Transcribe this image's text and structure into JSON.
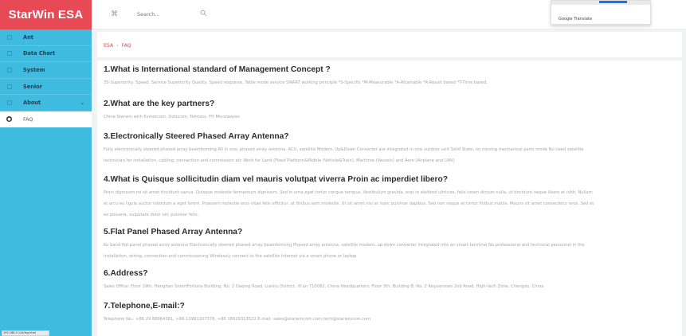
{
  "app": {
    "brand": "StarWin ESA"
  },
  "sidebar": {
    "items": [
      {
        "label": "Ant"
      },
      {
        "label": "Data Chart"
      },
      {
        "label": "System"
      },
      {
        "label": "Senior"
      },
      {
        "label": "About"
      }
    ],
    "subitems": [
      {
        "label": "FAQ"
      }
    ]
  },
  "header": {
    "close_glyph": "⌘",
    "search_placeholder": "Search...",
    "translate_label": "Google Translate"
  },
  "breadcrumb": {
    "root": "ESA",
    "current": "FAQ"
  },
  "status_text": "192.168.0.1/#/faq.html",
  "faq": [
    {
      "q": "1.What is International standard of Management Concept ?",
      "a": [
        "3S-Superiority, Speed, Service Superiority Quality, Speed response, Table mode service SMART working principle *S-Specific *M-Measurable *A-Attainable *R-Result based *T-Time based."
      ]
    },
    {
      "q": "2.What are the key partners?",
      "a": [
        "China Starwin with Evmorcom,  Dotocom,  Telmoss,  FH Microwaves"
      ]
    },
    {
      "q": "3.Electronically Steered Phased Array Antenna?",
      "a": [
        "Fully electronically steered phased array beamforming All in one, phased array antenna, ACU, satellite Modem, Up&Down Converter are integrated in one outdoor unit Solid State, no moving mechanical parts mode No need satellite",
        "technician for installation, cabling, connection and commission etc Work for Land (Fixed Platform&Mobile (Vehicle&Train), Maritime (Vessels) and Aero (Airplane and UAV)"
      ]
    },
    {
      "q": "4.What is Quisque sollicitudin diam vel mauris volutpat viverra Proin ac imperdiet libero?",
      "a": [
        "Proin dignissim mi sit amet tincidunt varius. Quisque molestie fermentum dignissim. Sed in urna eget tortor congue tempus. Vestibulum gravida, erat in eleifend ultricies, felis lorem dictum nulla, ut tincidunt neque libero et nibh. Nullam",
        "et arcu eu ligula auctor interdum a eget lorem. Praesent molestie eros vitae felis efficitur, at finibus sem molestie. Ut sit amet nisi at nunc pulvinar dapibus. Sed non neque et tortor finibus mattis. Mauris sit amet consectetur eros. Sed et",
        "ex posuere, vulputate dolor vel, pulvinar felis."
      ]
    },
    {
      "q": "5.Flat Panel Phased Array Antenna?",
      "a": [
        "Ku band flat panel phased array antenna Electronically steered phased array beamforming Phased array antenna, satellite modem, up-down converter integrated into an smart terminal No professional and technical personnel in the",
        "installation, wiring, connection and commissioning Wirelessly connect to the satellite Internet via a smart phone or laptop"
      ]
    },
    {
      "q": "6.Address?",
      "a": [
        "Sales Office: Floor 19th, Hengtian SmartFortune Building, No. 2 Daqing Road, Lianhu District, Xi'an 710082, China Headquarters: Floor 3th, Building B, No. 2 Keyuanmen 2nd Road, High-tech Zone, Chengdu, China"
      ]
    },
    {
      "q": "7.Telephone,E-mail:?",
      "a": [
        "Telephone No.: +86 29 88664381, +86 13991207378, +86 18629313522 E-mail: sales@starwincom.com tech@starwincom.com"
      ]
    }
  ]
}
